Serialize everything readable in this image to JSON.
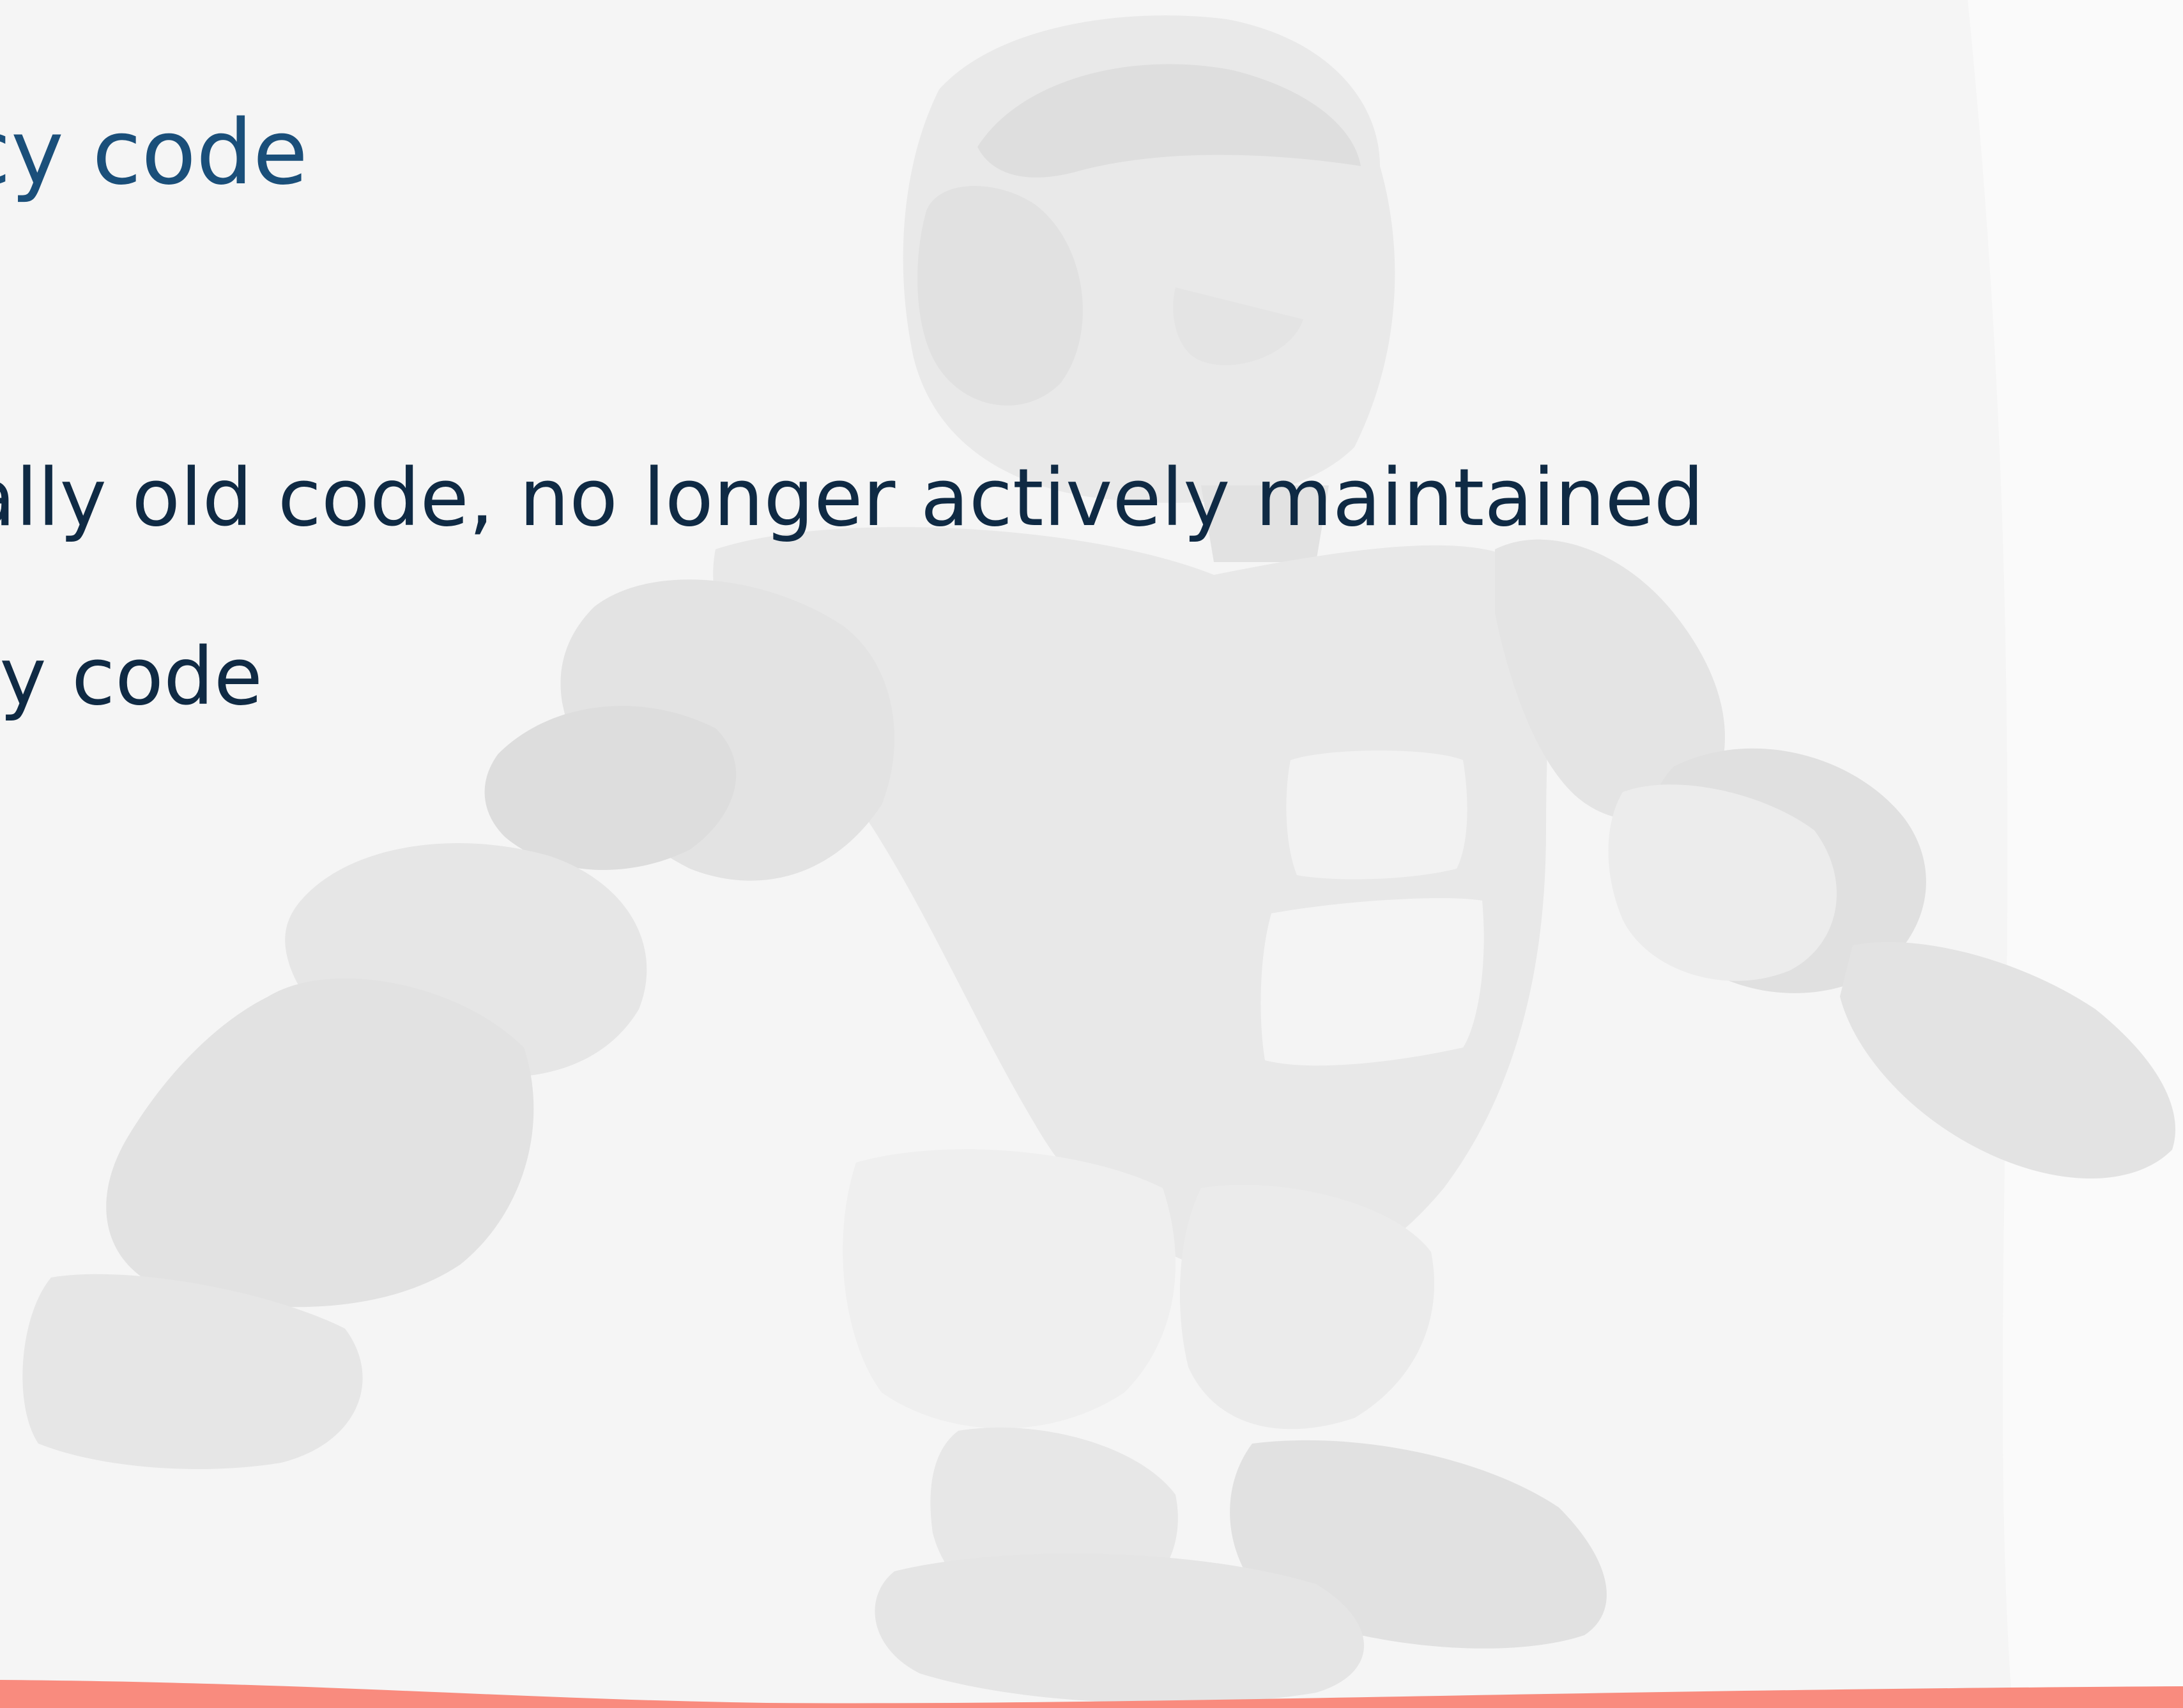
{
  "slide": {
    "title": "cy code",
    "bullets": [
      "ually old code, no longer actively maintained",
      "ssy code"
    ]
  },
  "background": {
    "illustration": "robot-illustration",
    "color": "#f5f5f5"
  },
  "colors": {
    "title": "#1a4f7a",
    "body_text": "#0f2a44",
    "accent_wave": "#f98b7e"
  }
}
